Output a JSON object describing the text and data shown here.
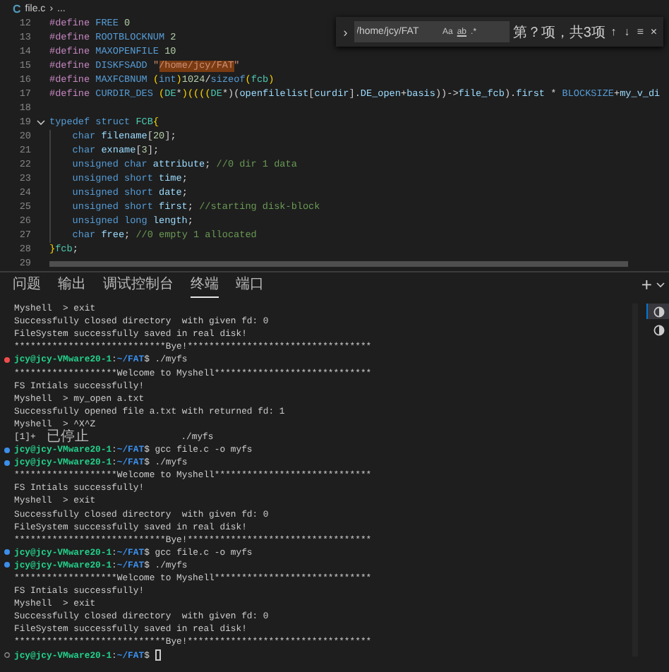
{
  "breadcrumb": {
    "lang_icon": "C",
    "file": "file.c",
    "separator": "›",
    "more": "..."
  },
  "find": {
    "toggle": "›",
    "value": "/home/jcy/FAT",
    "options": [
      "Aa",
      "ab",
      ".*"
    ],
    "count": "第？项，共3项",
    "actions": [
      "↑",
      "↓",
      "≡",
      "×"
    ]
  },
  "code_lines": [
    {
      "number": "12",
      "indent_guide": false,
      "tokens": [
        {
          "kind": "kw",
          "text": "#define"
        },
        {
          "kind": "mac",
          "text": " FREE"
        },
        {
          "kind": "num",
          "text": " 0"
        }
      ]
    },
    {
      "number": "13",
      "indent_guide": false,
      "tokens": [
        {
          "kind": "kw",
          "text": "#define"
        },
        {
          "kind": "mac",
          "text": " ROOTBLOCKNUM"
        },
        {
          "kind": "num",
          "text": " 2"
        }
      ]
    },
    {
      "number": "14",
      "indent_guide": false,
      "tokens": [
        {
          "kind": "kw",
          "text": "#define"
        },
        {
          "kind": "mac",
          "text": " MAXOPENFILE"
        },
        {
          "kind": "num",
          "text": " 10"
        }
      ]
    },
    {
      "number": "15",
      "indent_guide": false,
      "tokens": [
        {
          "kind": "kw",
          "text": "#define"
        },
        {
          "kind": "mac",
          "text": " DISKFSADD"
        },
        {
          "kind": "str",
          "text": " \""
        },
        {
          "kind": "match",
          "text": "/home/jcy/FAT"
        },
        {
          "kind": "str",
          "text": "\""
        }
      ]
    },
    {
      "number": "16",
      "indent_guide": false,
      "tokens": [
        {
          "kind": "kw",
          "text": "#define"
        },
        {
          "kind": "mac",
          "text": " MAXFCBNUM"
        },
        {
          "kind": "brace",
          "text": " ("
        },
        {
          "kind": "type",
          "text": "int"
        },
        {
          "kind": "brace",
          "text": ")"
        },
        {
          "kind": "num",
          "text": "1024"
        },
        {
          "kind": "plain",
          "text": "/"
        },
        {
          "kind": "type",
          "text": "sizeof"
        },
        {
          "kind": "brace",
          "text": "("
        },
        {
          "kind": "cls",
          "text": "fcb"
        },
        {
          "kind": "brace",
          "text": ")"
        }
      ]
    },
    {
      "number": "17",
      "indent_guide": false,
      "tokens": [
        {
          "kind": "kw",
          "text": "#define"
        },
        {
          "kind": "mac",
          "text": " CURDIR_DES"
        },
        {
          "kind": "brace",
          "text": " ("
        },
        {
          "kind": "cls",
          "text": "DE"
        },
        {
          "kind": "plain",
          "text": "*"
        },
        {
          "kind": "brace",
          "text": ")(((("
        },
        {
          "kind": "cls",
          "text": "DE"
        },
        {
          "kind": "plain",
          "text": "*)("
        },
        {
          "kind": "var",
          "text": "openfilelist"
        },
        {
          "kind": "plain",
          "text": "["
        },
        {
          "kind": "var",
          "text": "curdir"
        },
        {
          "kind": "plain",
          "text": "]."
        },
        {
          "kind": "var",
          "text": "DE_open"
        },
        {
          "kind": "plain",
          "text": "+"
        },
        {
          "kind": "var",
          "text": "basis"
        },
        {
          "kind": "plain",
          "text": "))->"
        },
        {
          "kind": "var",
          "text": "file_fcb"
        },
        {
          "kind": "plain",
          "text": ")."
        },
        {
          "kind": "var",
          "text": "first"
        },
        {
          "kind": "plain",
          "text": " * "
        },
        {
          "kind": "mac",
          "text": "BLOCKSIZE"
        },
        {
          "kind": "plain",
          "text": "+"
        },
        {
          "kind": "var",
          "text": "my_v_di"
        }
      ]
    },
    {
      "number": "18",
      "indent_guide": false
    },
    {
      "number": "19",
      "indent_guide": false,
      "expanded": true,
      "tokens": [
        {
          "kind": "type",
          "text": "typedef struct"
        },
        {
          "kind": "cls",
          "text": " FCB"
        },
        {
          "kind": "brace",
          "text": "{"
        }
      ]
    },
    {
      "number": "20",
      "indent_guide": true,
      "tokens": [
        {
          "kind": "type",
          "text": "char"
        },
        {
          "kind": "var",
          "text": " filename"
        },
        {
          "kind": "plain",
          "text": "["
        },
        {
          "kind": "num",
          "text": "20"
        },
        {
          "kind": "plain",
          "text": "];"
        }
      ]
    },
    {
      "number": "21",
      "indent_guide": true,
      "tokens": [
        {
          "kind": "type",
          "text": "char"
        },
        {
          "kind": "var",
          "text": " exname"
        },
        {
          "kind": "plain",
          "text": "["
        },
        {
          "kind": "num",
          "text": "3"
        },
        {
          "kind": "plain",
          "text": "];"
        }
      ]
    },
    {
      "number": "22",
      "indent_guide": true,
      "tokens": [
        {
          "kind": "type",
          "text": "unsigned char"
        },
        {
          "kind": "var",
          "text": " attribute"
        },
        {
          "kind": "plain",
          "text": ";"
        },
        {
          "kind": "cmt",
          "text": " //0 dir 1 data"
        }
      ]
    },
    {
      "number": "23",
      "indent_guide": true,
      "tokens": [
        {
          "kind": "type",
          "text": "unsigned short"
        },
        {
          "kind": "var",
          "text": " time"
        },
        {
          "kind": "plain",
          "text": ";"
        }
      ]
    },
    {
      "number": "24",
      "indent_guide": true,
      "tokens": [
        {
          "kind": "type",
          "text": "unsigned short"
        },
        {
          "kind": "var",
          "text": " date"
        },
        {
          "kind": "plain",
          "text": ";"
        }
      ]
    },
    {
      "number": "25",
      "indent_guide": true,
      "tokens": [
        {
          "kind": "type",
          "text": "unsigned short"
        },
        {
          "kind": "var",
          "text": " first"
        },
        {
          "kind": "plain",
          "text": ";"
        },
        {
          "kind": "cmt",
          "text": " //starting disk-block"
        }
      ]
    },
    {
      "number": "26",
      "indent_guide": true,
      "tokens": [
        {
          "kind": "type",
          "text": "unsigned long"
        },
        {
          "kind": "var",
          "text": " length"
        },
        {
          "kind": "plain",
          "text": ";"
        }
      ]
    },
    {
      "number": "27",
      "indent_guide": true,
      "tokens": [
        {
          "kind": "type",
          "text": "char"
        },
        {
          "kind": "var",
          "text": " free"
        },
        {
          "kind": "plain",
          "text": ";"
        },
        {
          "kind": "cmt",
          "text": " //0 empty 1 allocated"
        }
      ]
    },
    {
      "number": "28",
      "indent_guide": false,
      "tokens": [
        {
          "kind": "brace",
          "text": "}"
        },
        {
          "kind": "cls",
          "text": "fcb"
        },
        {
          "kind": "plain",
          "text": ";"
        }
      ]
    },
    {
      "number": "29",
      "indent_guide": false
    }
  ],
  "panel": {
    "tabs": [
      {
        "label": "问题",
        "selected": false
      },
      {
        "label": "输出",
        "selected": false
      },
      {
        "label": "调试控制台",
        "selected": false
      },
      {
        "label": "终端",
        "selected": true
      },
      {
        "label": "端口",
        "selected": false
      }
    ],
    "add": "+"
  },
  "terminal_instances": [
    {
      "selected": true
    },
    {
      "selected": false
    }
  ],
  "terminal": [
    {
      "kind": "output",
      "text": "Myshell  > exit"
    },
    {
      "kind": "output",
      "text": "Successfully closed directory  with given fd: 0"
    },
    {
      "kind": "output",
      "text": "FileSystem successfully saved in real disk!"
    },
    {
      "kind": "output",
      "text": "****************************Bye!**********************************"
    },
    {
      "kind": "prompt",
      "color": "#f14c4c",
      "user": "jcy@jcy-VMware20-1",
      "separator": ":",
      "path": "~/FAT",
      "symbol": "$",
      "command": " ./myfs"
    },
    {
      "kind": "output",
      "text": "*******************Welcome to Myshell*****************************"
    },
    {
      "kind": "output",
      "text": "FS Intials successfully!"
    },
    {
      "kind": "output",
      "text": "Myshell  > my_open a.txt"
    },
    {
      "kind": "output",
      "text": "Successfully opened file a.txt with returned fd: 1"
    },
    {
      "kind": "output",
      "text": "Myshell  > ^X^Z"
    },
    {
      "kind": "output",
      "text": "[1]+  已停止                 ./myfs"
    },
    {
      "kind": "prompt",
      "color": "#3b8eea",
      "user": "jcy@jcy-VMware20-1",
      "separator": ":",
      "path": "~/FAT",
      "symbol": "$",
      "command": " gcc file.c -o myfs"
    },
    {
      "kind": "prompt",
      "color": "#3b8eea",
      "user": "jcy@jcy-VMware20-1",
      "separator": ":",
      "path": "~/FAT",
      "symbol": "$",
      "command": " ./myfs"
    },
    {
      "kind": "output",
      "text": "*******************Welcome to Myshell*****************************"
    },
    {
      "kind": "output",
      "text": "FS Intials successfully!"
    },
    {
      "kind": "output",
      "text": "Myshell  > exit"
    },
    {
      "kind": "output",
      "text": "Successfully closed directory  with given fd: 0"
    },
    {
      "kind": "output",
      "text": "FileSystem successfully saved in real disk!"
    },
    {
      "kind": "output",
      "text": "****************************Bye!**********************************"
    },
    {
      "kind": "prompt",
      "color": "#3b8eea",
      "user": "jcy@jcy-VMware20-1",
      "separator": ":",
      "path": "~/FAT",
      "symbol": "$",
      "command": " gcc file.c -o myfs"
    },
    {
      "kind": "prompt",
      "color": "#3b8eea",
      "user": "jcy@jcy-VMware20-1",
      "separator": ":",
      "path": "~/FAT",
      "symbol": "$",
      "command": " ./myfs"
    },
    {
      "kind": "output",
      "text": "*******************Welcome to Myshell*****************************"
    },
    {
      "kind": "output",
      "text": "FS Intials successfully!"
    },
    {
      "kind": "output",
      "text": "Myshell  > exit"
    },
    {
      "kind": "output",
      "text": "Successfully closed directory  with given fd: 0"
    },
    {
      "kind": "output",
      "text": "FileSystem successfully saved in real disk!"
    },
    {
      "kind": "output",
      "text": "****************************Bye!**********************************"
    },
    {
      "kind": "input",
      "user": "jcy@jcy-VMware20-1",
      "separator": ":",
      "path": "~/FAT",
      "symbol": "$"
    }
  ]
}
